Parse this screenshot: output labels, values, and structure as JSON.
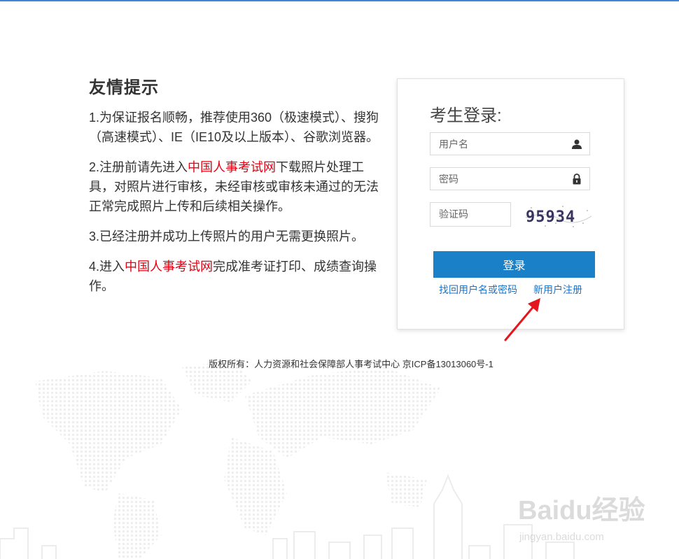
{
  "tips": {
    "title": "友情提示",
    "p1": "1.为保证报名顺畅，推荐使用360（极速模式）、搜狗（高速模式）、IE（IE10及以上版本）、谷歌浏览器。",
    "p2_before": "2.注册前请先进入",
    "p2_link": "中国人事考试网",
    "p2_after": "下载照片处理工具，对照片进行审核，未经审核或审核未通过的无法正常完成照片上传和后续相关操作。",
    "p3": "3.已经注册并成功上传照片的用户无需更换照片。",
    "p4_before": "4.进入",
    "p4_link": "中国人事考试网",
    "p4_after": "完成准考证打印、成绩查询操作。"
  },
  "login": {
    "title": "考生登录:",
    "username_placeholder": "用户名",
    "password_placeholder": "密码",
    "captcha_placeholder": "验证码",
    "captcha_text": "95934",
    "login_button": "登录",
    "recover_link": "找回用户名或密码",
    "register_link": "新用户注册"
  },
  "footer": {
    "copyright": "版权所有：人力资源和社会保障部人事考试中心 京ICP备13013060号-1"
  },
  "watermark": {
    "brand": "Baidu经验",
    "url": "jingyan.baidu.com"
  },
  "colors": {
    "accent": "#1a80c8",
    "link": "#1a73c9",
    "highlight": "#e60012",
    "arrow": "#e3161d"
  }
}
